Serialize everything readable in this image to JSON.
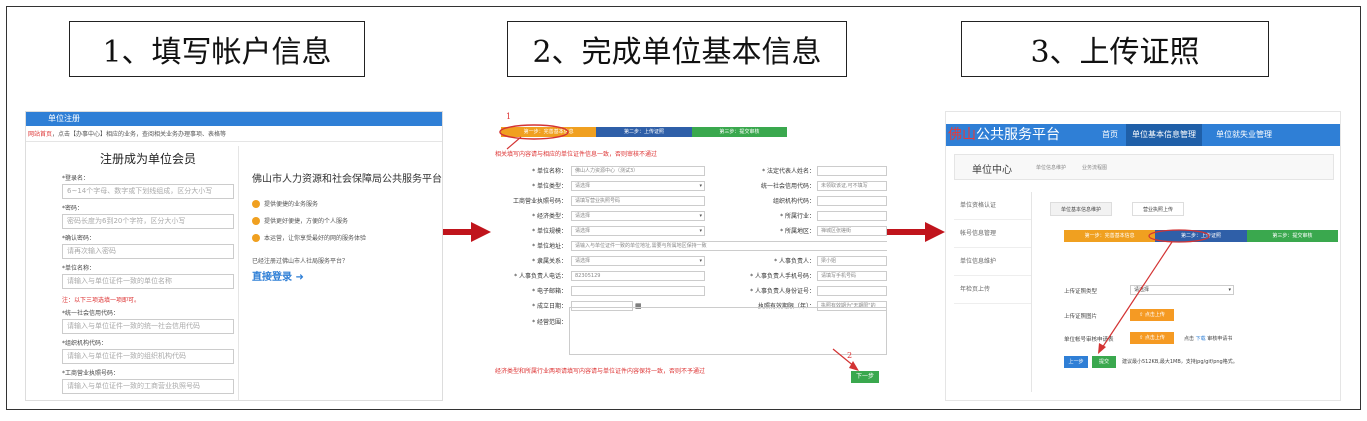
{
  "steps": [
    {
      "title": "1、填写帐户信息"
    },
    {
      "title": "2、完成单位基本信息"
    },
    {
      "title": "3、上传证照"
    }
  ],
  "panel1": {
    "header": "单位注册",
    "breadcrumb_link": "网站首页",
    "breadcrumb_rest": "，点击【办事中心】相应的业务，查阅相关业务办理事项、表格等",
    "form_title": "注册成为单位会员",
    "fields": [
      {
        "label": "*登录名：",
        "placeholder": "6~14个字母、数字或下划线组成，区分大小写"
      },
      {
        "label": "*密码：",
        "placeholder": "密码长度为6到20个字符，区分大小写"
      },
      {
        "label": "*确认密码：",
        "placeholder": "请再次输入密码"
      },
      {
        "label": "*单位名称：",
        "placeholder": "请输入与单位证件一致的单位名称"
      }
    ],
    "note": "注：以下三项选填一项即可。",
    "fields2": [
      {
        "label": "*统一社会信用代码：",
        "placeholder": "请输入与单位证件一致的统一社会信用代码"
      },
      {
        "label": "*组织机构代码：",
        "placeholder": "请输入与单位证件一致的组织机构代码"
      },
      {
        "label": "*工商营业执照号码：",
        "placeholder": "请输入与单位证件一致的工商营业执照号码"
      }
    ],
    "side_title": "佛山市人力资源和社会保障局公共服务平台",
    "features": [
      "提供便捷的业务服务",
      "提供更好便捷，方便的个人服务",
      "本运营，让你享受最好的网的服务体验"
    ],
    "question": "已经注册过佛山市人社局服务平台？",
    "login_link": "直接登录"
  },
  "panel2": {
    "tabs": [
      "第一步：完善基本信息",
      "第二步：上传证照",
      "第三步：提交审核"
    ],
    "tab_colors": [
      "#f0a020",
      "#2f5fa8",
      "#3aa84e"
    ],
    "note": "相关填写内容请与相应的单位证件信息一致，否则审核不通过",
    "left_rows": [
      {
        "label": "* 单位名称：",
        "value": "佛山人力资源中心（测试3）",
        "dd": false
      },
      {
        "label": "* 单位类型：",
        "value": "请选择",
        "dd": true
      },
      {
        "label": "工商营业执照号码：",
        "value": "请填写营业执照号码",
        "dd": false
      },
      {
        "label": "* 经济类型：",
        "value": "请选择",
        "dd": true
      },
      {
        "label": "* 单位规模：",
        "value": "请选择",
        "dd": true
      },
      {
        "label": "* 单位地址：",
        "value": "请输入与单位证件一致的单位地址,需要与所属地区保持一致",
        "dd": false
      },
      {
        "label": "* 隶属关系：",
        "value": "请选择",
        "dd": true
      },
      {
        "label": "* 人事负责人电话：",
        "value": "82305129",
        "dd": false
      },
      {
        "label": "* 电子邮箱：",
        "value": "",
        "dd": false
      },
      {
        "label": "* 成立日期：",
        "value": "",
        "dd": false
      },
      {
        "label": "* 经营范围：",
        "value": "",
        "dd": false
      }
    ],
    "right_rows": [
      {
        "label": "* 法定代表人姓名：",
        "value": "",
        "dd": false
      },
      {
        "label": "统一社会信用代码：",
        "value": "未领取该证,可不填写",
        "dd": false
      },
      {
        "label": "组织机构代码：",
        "value": "",
        "dd": false
      },
      {
        "label": "* 所属行业：",
        "value": "",
        "dd": false
      },
      {
        "label": "* 所属地区：",
        "value": "禅城区张槎街",
        "dd": false
      },
      {
        "label": "",
        "value": "",
        "dd": false
      },
      {
        "label": "* 人事负责人：",
        "value": "梁小姐",
        "dd": false
      },
      {
        "label": "* 人事负责人手机号码：",
        "value": "请填写手机号码",
        "dd": false
      },
      {
        "label": "* 人事负责人身份证号：",
        "value": "",
        "dd": false
      },
      {
        "label": "执照有效期限（年）：",
        "value": "执照有效期为\"无期限\"的",
        "dd": false
      }
    ],
    "bottom_note": "经济类型和所属行业两项请填写内容请与单位证件内容保持一致，否则不予通过",
    "next_button": "下一步",
    "annotation_1": "1",
    "annotation_2": "2"
  },
  "panel3": {
    "brand_red": "佛山",
    "brand_rest": "公共服务平台",
    "nav": [
      "首页",
      "单位基本信息管理",
      "单位就失业管理"
    ],
    "subnav_title": "单位中心",
    "subnav_links": [
      "单位信息维护",
      "业务流程图"
    ],
    "left_nav": [
      "单位资格认证",
      "帐号信息管理",
      "单位信息维护",
      "年检页上传"
    ],
    "inner_tabs": [
      "单位基本信息维护",
      "营业执照上传"
    ],
    "step_tabs": [
      "第一步：完善基本信息",
      "第二步：上传证照",
      "第三步：提交审核"
    ],
    "field_labels": [
      "上传证照类型",
      "上传证照图片",
      "单位帐号审核申请表"
    ],
    "select_value": "请选择",
    "upload_label": "点击上传",
    "download_pre": "点击",
    "download_link": "下载",
    "download_post": "审核申请书",
    "prev_button": "上一步",
    "submit_button": "提交",
    "file_tip": "建议最小512KB,最大1MB，支持jpg/gif/png格式。"
  },
  "colors": {
    "arrow": "#c0141c",
    "annotation": "#d33333"
  }
}
